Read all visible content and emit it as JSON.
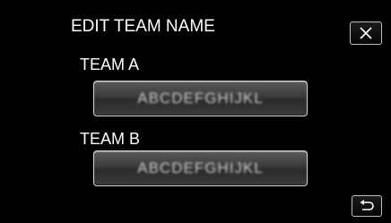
{
  "screen": {
    "title": "EDIT TEAM NAME"
  },
  "teams": [
    {
      "label": "TEAM A",
      "value": "ABCDEFGHIJKL"
    },
    {
      "label": "TEAM B",
      "value": "ABCDEFGHIJKL"
    }
  ],
  "icons": {
    "close": "close-icon",
    "back": "return-arrow-icon"
  },
  "colors": {
    "background": "#000000",
    "text": "#ffffff",
    "field_border": "#d6d6d6"
  }
}
